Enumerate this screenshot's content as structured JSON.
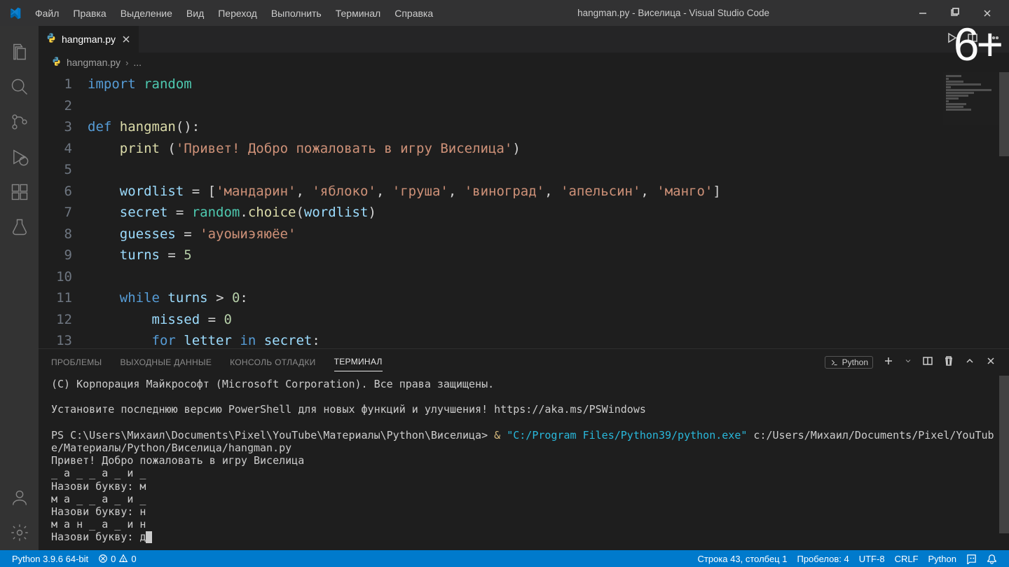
{
  "titlebar": {
    "title": "hangman.py - Виселица - Visual Studio Code",
    "menu": [
      "Файл",
      "Правка",
      "Выделение",
      "Вид",
      "Переход",
      "Выполнить",
      "Терминал",
      "Справка"
    ]
  },
  "watermark": "6+",
  "tab": {
    "label": "hangman.py"
  },
  "breadcrumb": {
    "file": "hangman.py",
    "more": "..."
  },
  "code": {
    "lines": [
      {
        "n": "1",
        "tokens": [
          [
            "kw",
            "import"
          ],
          [
            "op",
            " "
          ],
          [
            "mod",
            "random"
          ]
        ]
      },
      {
        "n": "2",
        "tokens": []
      },
      {
        "n": "3",
        "tokens": [
          [
            "kw",
            "def"
          ],
          [
            "op",
            " "
          ],
          [
            "fn",
            "hangman"
          ],
          [
            "paren",
            "():"
          ]
        ]
      },
      {
        "n": "4",
        "tokens": [
          [
            "op",
            "    "
          ],
          [
            "fn",
            "print"
          ],
          [
            "op",
            " "
          ],
          [
            "paren",
            "("
          ],
          [
            "str",
            "'Привет! Добро пожаловать в игру Виселица'"
          ],
          [
            "paren",
            ")"
          ]
        ]
      },
      {
        "n": "5",
        "tokens": [
          [
            "op",
            "    "
          ]
        ]
      },
      {
        "n": "6",
        "tokens": [
          [
            "op",
            "    "
          ],
          [
            "var",
            "wordlist"
          ],
          [
            "op",
            " = "
          ],
          [
            "paren",
            "["
          ],
          [
            "str",
            "'мандарин'"
          ],
          [
            "comma",
            ", "
          ],
          [
            "str",
            "'яблоко'"
          ],
          [
            "comma",
            ", "
          ],
          [
            "str",
            "'груша'"
          ],
          [
            "comma",
            ", "
          ],
          [
            "str",
            "'виноград'"
          ],
          [
            "comma",
            ", "
          ],
          [
            "str",
            "'апельсин'"
          ],
          [
            "comma",
            ", "
          ],
          [
            "str",
            "'манго'"
          ],
          [
            "paren",
            "]"
          ]
        ]
      },
      {
        "n": "7",
        "tokens": [
          [
            "op",
            "    "
          ],
          [
            "var",
            "secret"
          ],
          [
            "op",
            " = "
          ],
          [
            "mod",
            "random"
          ],
          [
            "op",
            "."
          ],
          [
            "fn",
            "choice"
          ],
          [
            "paren",
            "("
          ],
          [
            "var",
            "wordlist"
          ],
          [
            "paren",
            ")"
          ]
        ]
      },
      {
        "n": "8",
        "tokens": [
          [
            "op",
            "    "
          ],
          [
            "var",
            "guesses"
          ],
          [
            "op",
            " = "
          ],
          [
            "str",
            "'ауоыиэяюёе'"
          ]
        ]
      },
      {
        "n": "9",
        "tokens": [
          [
            "op",
            "    "
          ],
          [
            "var",
            "turns"
          ],
          [
            "op",
            " = "
          ],
          [
            "num",
            "5"
          ]
        ]
      },
      {
        "n": "10",
        "tokens": []
      },
      {
        "n": "11",
        "tokens": [
          [
            "op",
            "    "
          ],
          [
            "kw",
            "while"
          ],
          [
            "op",
            " "
          ],
          [
            "var",
            "turns"
          ],
          [
            "op",
            " > "
          ],
          [
            "num",
            "0"
          ],
          [
            "paren",
            ":"
          ]
        ]
      },
      {
        "n": "12",
        "tokens": [
          [
            "op",
            "        "
          ],
          [
            "var",
            "missed"
          ],
          [
            "op",
            " = "
          ],
          [
            "num",
            "0"
          ]
        ]
      },
      {
        "n": "13",
        "tokens": [
          [
            "op",
            "        "
          ],
          [
            "kw",
            "for"
          ],
          [
            "op",
            " "
          ],
          [
            "var",
            "letter"
          ],
          [
            "op",
            " "
          ],
          [
            "kw",
            "in"
          ],
          [
            "op",
            " "
          ],
          [
            "var",
            "secret"
          ],
          [
            "paren",
            ":"
          ]
        ]
      }
    ]
  },
  "panel": {
    "tabs": [
      "ПРОБЛЕМЫ",
      "ВЫХОДНЫЕ ДАННЫЕ",
      "КОНСОЛЬ ОТЛАДКИ",
      "ТЕРМИНАЛ"
    ],
    "active": 3,
    "terminal_type": "Python",
    "content": [
      {
        "t": "(C) Корпорация Майкрософт (Microsoft Corporation). Все права защищены."
      },
      {
        "t": ""
      },
      {
        "t": "Установите последнюю версию PowerShell для новых функций и улучшения! https://aka.ms/PSWindows"
      },
      {
        "t": ""
      },
      {
        "segments": [
          {
            "cls": "",
            "t": "PS C:\\Users\\Михаил\\Documents\\Pixel\\YouTube\\Материалы\\Python\\Виселица> "
          },
          {
            "cls": "term-yellow",
            "t": "& "
          },
          {
            "cls": "term-cyan",
            "t": "\"C:/Program Files/Python39/python.exe\""
          },
          {
            "cls": "",
            "t": " c:/Users/Михаил/Documents/Pixel/YouTube/Материалы/Python/Виселица/hangman.py"
          }
        ]
      },
      {
        "t": "Привет! Добро пожаловать в игру Виселица"
      },
      {
        "t": "_ а _ _ а _ и _"
      },
      {
        "t": "Назови букву: м"
      },
      {
        "t": "м а _ _ а _ и _"
      },
      {
        "t": "Назови букву: н"
      },
      {
        "t": "м а н _ а _ и н"
      },
      {
        "segments": [
          {
            "cls": "",
            "t": "Назови букву: д"
          },
          {
            "cls": "term-cursor",
            "t": " "
          }
        ]
      }
    ]
  },
  "statusbar": {
    "python_version": "Python 3.9.6 64-bit",
    "errors": "0",
    "warnings": "0",
    "cursor": "Строка 43, столбец 1",
    "spaces": "Пробелов: 4",
    "encoding": "UTF-8",
    "eol": "CRLF",
    "lang": "Python"
  }
}
